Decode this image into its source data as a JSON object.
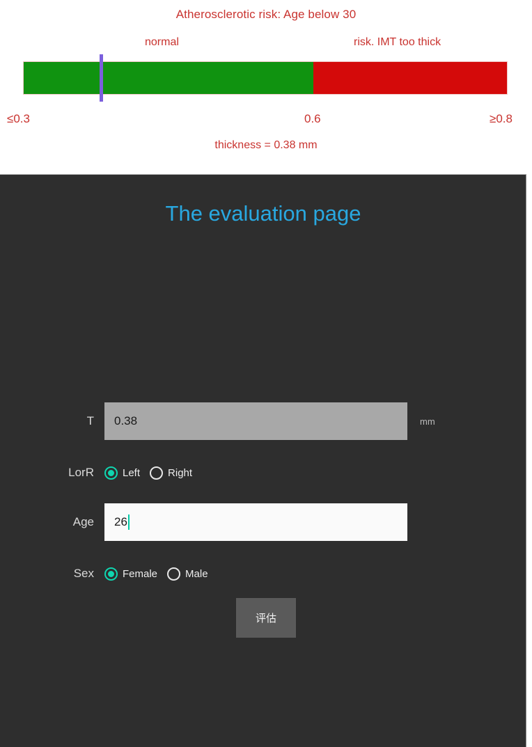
{
  "risk_panel": {
    "title": "Atherosclerotic risk: Age below 30",
    "zone_normal_label": "normal",
    "zone_risk_label": "risk. IMT too thick",
    "scale_min": "≤0.3",
    "scale_mid": "0.6",
    "scale_max": "≥0.8",
    "readout": "thickness = 0.38 mm",
    "colors": {
      "normal": "#109310",
      "risk": "#d40a0a",
      "marker": "#7b5fdd",
      "text": "#c9332f"
    }
  },
  "chart_data": {
    "type": "bar",
    "title": "Atherosclerotic risk: Age below 30",
    "orientation": "horizontal",
    "xlabel": "",
    "ylabel": "",
    "xlim": [
      0.3,
      0.8
    ],
    "grid": false,
    "legend": "none",
    "tick_labels": [
      "≤0.3",
      "0.6",
      "≥0.8"
    ],
    "tick_values": [
      0.3,
      0.6,
      0.8
    ],
    "categories": [
      "normal",
      "risk. IMT too thick"
    ],
    "segments": [
      {
        "name": "normal",
        "range": [
          0.3,
          0.6
        ],
        "color": "#109310",
        "width_fraction": 0.6
      },
      {
        "name": "risk. IMT too thick",
        "range": [
          0.6,
          0.8
        ],
        "color": "#d40a0a",
        "width_fraction": 0.4
      }
    ],
    "marker": {
      "label": "thickness",
      "value": 0.38,
      "unit": "mm",
      "color": "#7b5fdd",
      "position_fraction": 0.158
    },
    "annotations": [
      "thickness = 0.38 mm"
    ]
  },
  "app": {
    "title": "The evaluation page",
    "ghost_text": "",
    "fields": {
      "thickness": {
        "label": "T",
        "value": "0.38",
        "placeholder": "",
        "unit": "mm"
      },
      "side": {
        "label": "LorR",
        "options": [
          "Left",
          "Right"
        ],
        "selected": "Left"
      },
      "age": {
        "label": "Age",
        "value": "26",
        "placeholder": ""
      },
      "sex": {
        "label": "Sex",
        "options": [
          "Female",
          "Male"
        ],
        "selected": "Female"
      }
    },
    "submit_label": "评估",
    "accent_color": "#0fd6b0",
    "title_color": "#29a8e0"
  }
}
